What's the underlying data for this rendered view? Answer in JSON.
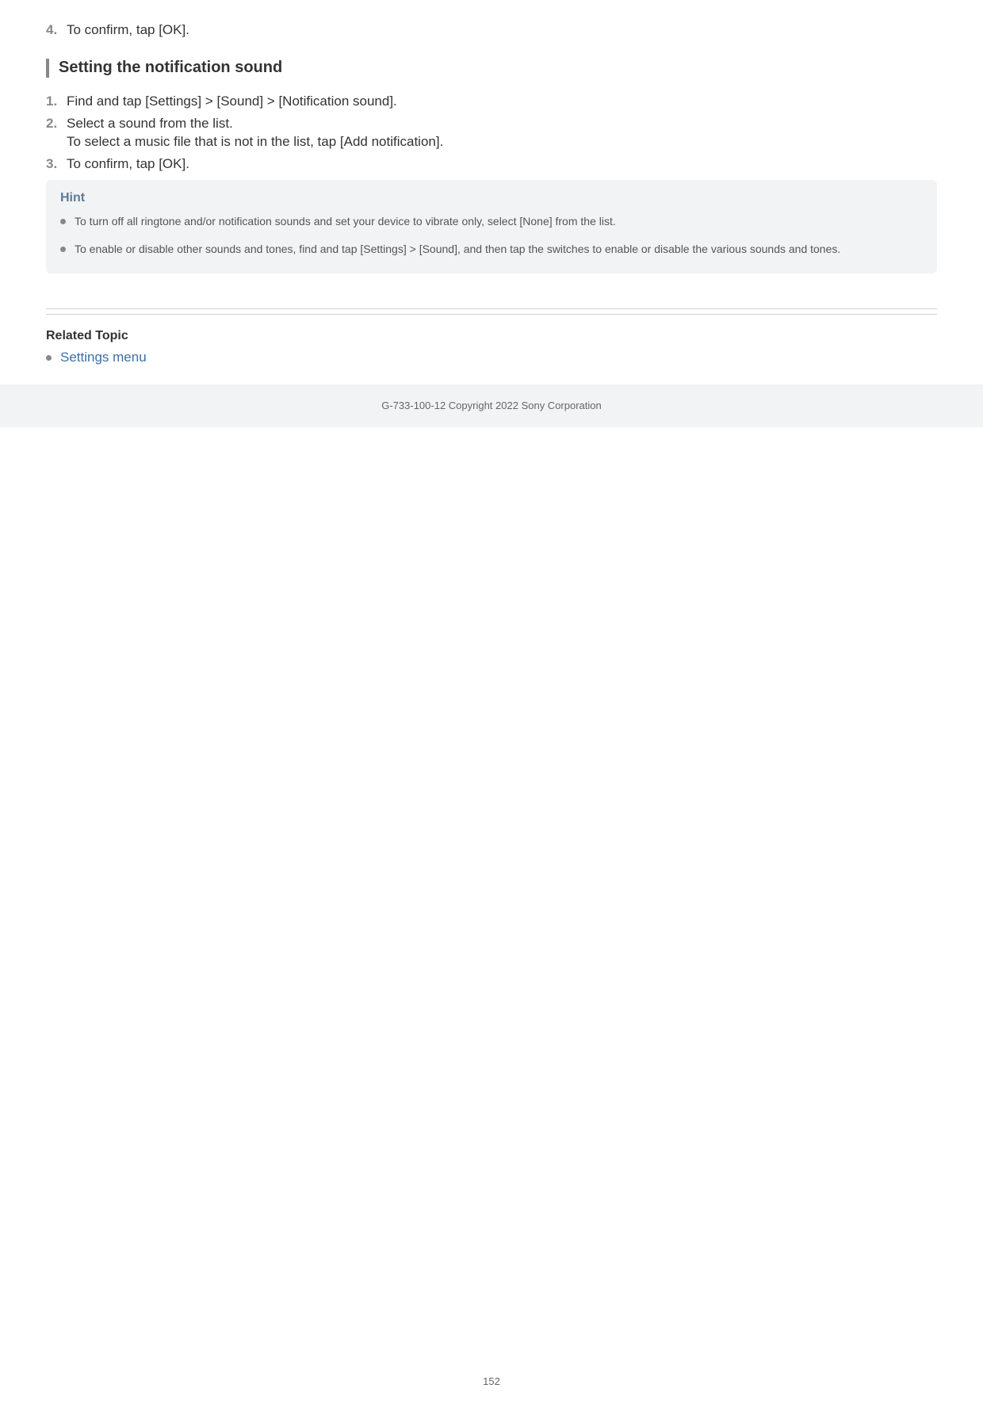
{
  "top_step": {
    "num": "4.",
    "text": "To confirm, tap [OK]."
  },
  "section_heading": "Setting the notification sound",
  "steps": [
    {
      "num": "1.",
      "text": "Find and tap [Settings] > [Sound] > [Notification sound]."
    },
    {
      "num": "2.",
      "text": "Select a sound from the list.",
      "sub": "To select a music file that is not in the list, tap [Add notification]."
    },
    {
      "num": "3.",
      "text": "To confirm, tap [OK]."
    }
  ],
  "hint": {
    "title": "Hint",
    "items": [
      "To turn off all ringtone and/or notification sounds and set your device to vibrate only, select [None] from the list.",
      "To enable or disable other sounds and tones, find and tap [Settings] > [Sound], and then tap the switches to enable or disable the various sounds and tones."
    ]
  },
  "related": {
    "title": "Related Topic",
    "link": "Settings menu"
  },
  "footer": "G-733-100-12 Copyright 2022 Sony Corporation",
  "page_number": "152"
}
